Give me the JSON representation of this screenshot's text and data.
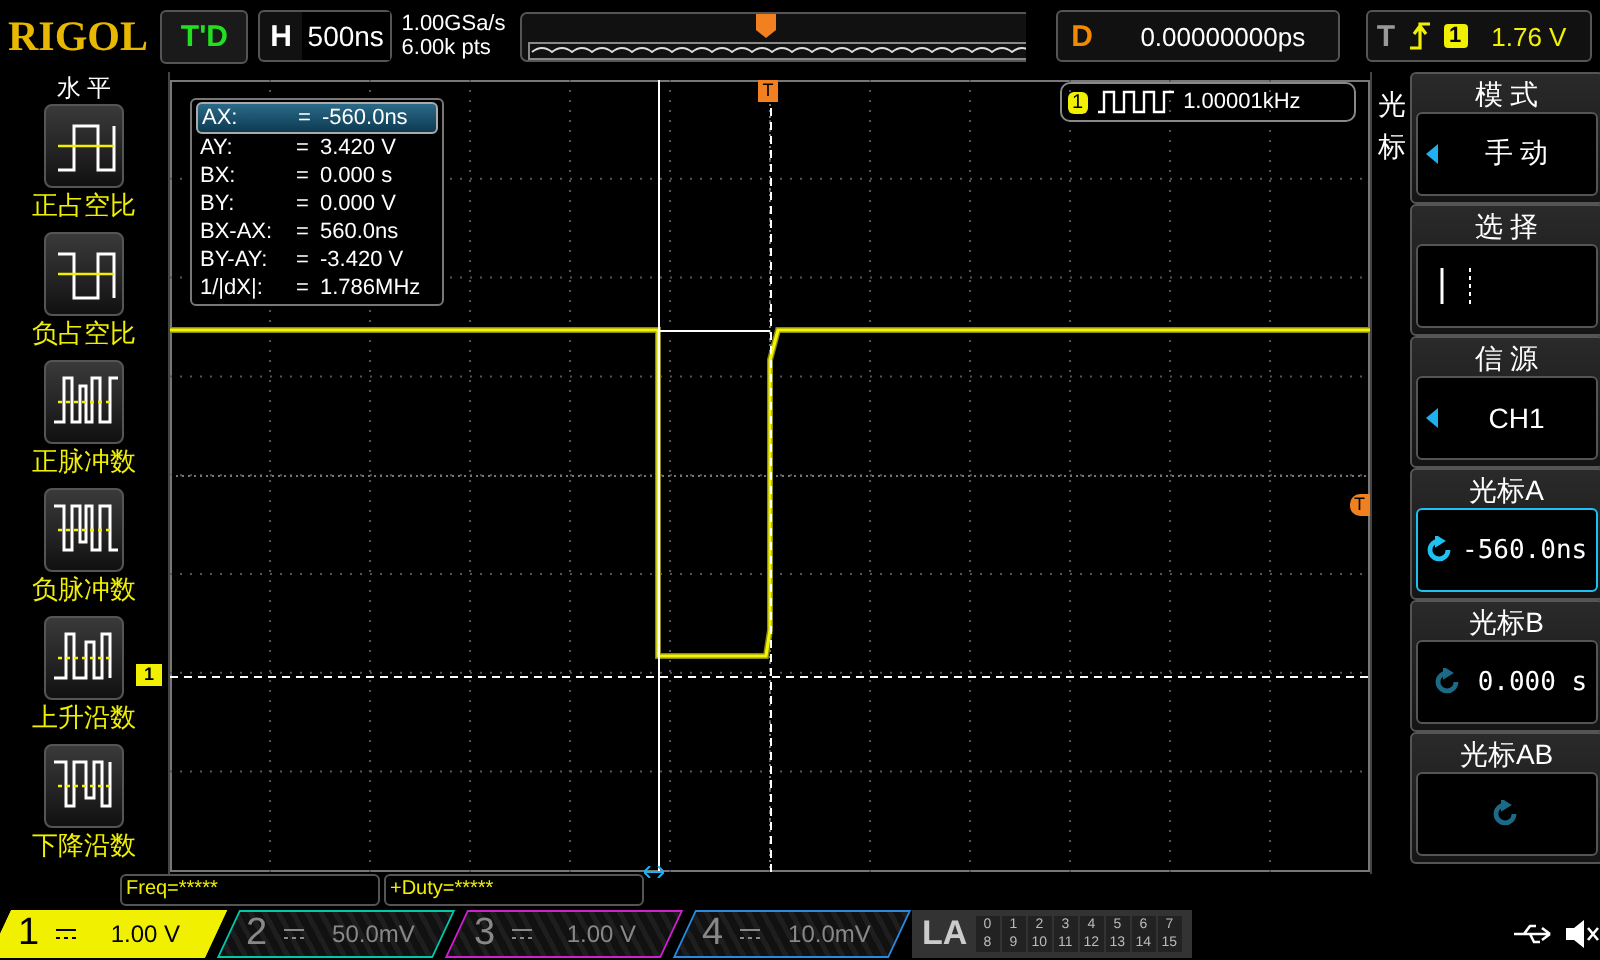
{
  "top_bar": {
    "logo": "RIGOL",
    "run_state": "T'D",
    "timebase": {
      "label": "H",
      "value": "500ns"
    },
    "sample_rate": "1.00GSa/s",
    "memory_depth": "6.00k pts",
    "delay": {
      "label": "D",
      "value": "0.00000000ps"
    },
    "trigger": {
      "label": "T",
      "source": "1",
      "level": "1.76 V"
    }
  },
  "left_menu": {
    "title": "水 平",
    "items": [
      {
        "label": "正占空比",
        "selected": false
      },
      {
        "label": "负占空比",
        "selected": false
      },
      {
        "label": "正脉冲数",
        "selected": false
      },
      {
        "label": "负脉冲数",
        "selected": false
      },
      {
        "label": "上升沿数",
        "selected": false
      },
      {
        "label": "下降沿数",
        "selected": false
      }
    ]
  },
  "cursor_readout": [
    {
      "label": "AX:",
      "sign": "=",
      "value": "-560.0ns",
      "selected": true
    },
    {
      "label": "AY:",
      "sign": "=",
      "value": "3.420 V",
      "selected": false
    },
    {
      "label": "BX:",
      "sign": "=",
      "value": "0.000 s",
      "selected": false
    },
    {
      "label": "BY:",
      "sign": "=",
      "value": "0.000 V",
      "selected": false
    },
    {
      "label": "BX-AX:",
      "sign": "=",
      "value": "560.0ns",
      "selected": false
    },
    {
      "label": "BY-AY:",
      "sign": "=",
      "value": "-3.420 V",
      "selected": false
    },
    {
      "label": "1/|dX|:",
      "sign": "=",
      "value": "1.786MHz",
      "selected": false
    }
  ],
  "counter": {
    "channel": "1",
    "value": "1.00001kHz"
  },
  "channel_marker": "1",
  "trigger_markers": {
    "position": "T",
    "level": "T"
  },
  "measurements": [
    "Freq=*****",
    "+Duty=*****"
  ],
  "right_menu": {
    "title": "光标",
    "items": [
      {
        "kind": "option",
        "label": "模 式",
        "value": "手 动",
        "active": false
      },
      {
        "kind": "cursor-select",
        "label": "选 择",
        "active": false
      },
      {
        "kind": "option",
        "label": "信 源",
        "value": "CH1",
        "active": false
      },
      {
        "kind": "knob",
        "label": "光标A",
        "value": "-560.0ns",
        "active": true
      },
      {
        "kind": "knob",
        "label": "光标B",
        "value": "0.000 s",
        "active": false
      },
      {
        "kind": "knob",
        "label": "光标AB",
        "active": false
      }
    ]
  },
  "channels": [
    {
      "number": "1",
      "scale": "1.00 V",
      "selected": true,
      "color": "#f0f000"
    },
    {
      "number": "2",
      "scale": "50.0mV",
      "selected": false,
      "color": "#00c8a8"
    },
    {
      "number": "3",
      "scale": "1.00 V",
      "selected": false,
      "color": "#d020d0"
    },
    {
      "number": "4",
      "scale": "10.0mV",
      "selected": false,
      "color": "#2a8ae0"
    }
  ],
  "logic_analyzer": {
    "label": "LA",
    "rows": [
      [
        "0",
        "1",
        "2",
        "3",
        "4",
        "5",
        "6",
        "7"
      ],
      [
        "8",
        "9",
        "10",
        "11",
        "12",
        "13",
        "14",
        "15"
      ]
    ]
  }
}
